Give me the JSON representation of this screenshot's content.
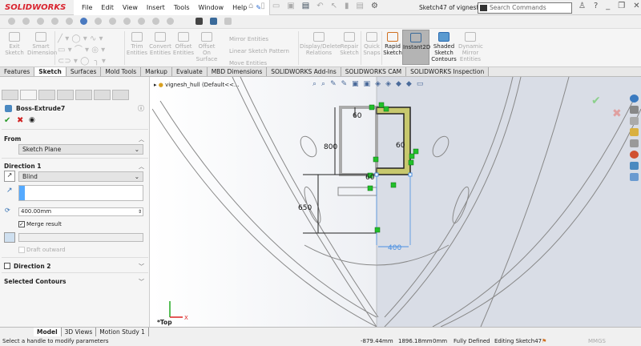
{
  "app": {
    "logo": "SOLIDWORKS",
    "document_title": "Sketch47 of vignesh_...",
    "search_placeholder": "Search Commands"
  },
  "menu": [
    "File",
    "Edit",
    "View",
    "Insert",
    "Tools",
    "Window",
    "Help"
  ],
  "ribbon": {
    "exit_sketch": "Exit Sketch",
    "smart_dimension": "Smart Dimension",
    "trim": "Trim Entities",
    "convert": "Convert Entities",
    "offset": "Offset Entities",
    "offset_surface": "Offset On Surface",
    "mirror": "Mirror Entities",
    "linear_pattern": "Linear Sketch Pattern",
    "move": "Move Entities",
    "display_delete": "Display/Delete Relations",
    "repair": "Repair Sketch",
    "quick_snaps": "Quick Snaps",
    "rapid_sketch": "Rapid Sketch",
    "instant2d": "Instant2D",
    "shaded_contours": "Shaded Sketch Contours",
    "dynamic_mirror": "Dynamic Mirror Entities"
  },
  "tabs": [
    "Features",
    "Sketch",
    "Surfaces",
    "Mold Tools",
    "Markup",
    "Evaluate",
    "MBD Dimensions",
    "SOLIDWORKS Add-Ins",
    "SOLIDWORKS CAM",
    "SOLIDWORKS Inspection"
  ],
  "active_tab": "Sketch",
  "feature": {
    "name": "Boss-Extrude7",
    "from": {
      "label": "From",
      "value": "Sketch Plane"
    },
    "direction1": {
      "label": "Direction 1",
      "end_condition": "Blind",
      "depth": "400.00mm",
      "merge_result": "Merge result",
      "merge_checked": true,
      "draft_outward": "Draft outward"
    },
    "direction2": "Direction 2",
    "selected_contours": "Selected Contours"
  },
  "tree": {
    "root": "vignesh_hull (Default<<..."
  },
  "dimensions": {
    "top": "60",
    "right": "60",
    "bottom": "60",
    "height": "800",
    "offset": "650",
    "width": "400"
  },
  "view_label": "*Top",
  "bottom_tabs": [
    "Model",
    "3D Views",
    "Motion Study 1"
  ],
  "status": {
    "message": "Select a handle to modify parameters",
    "x": "-879.44mm",
    "y": "1896.18mm",
    "z": "0mm",
    "state": "Fully Defined",
    "editing": "Editing Sketch47",
    "units": "MMGS"
  },
  "colors": {
    "brand": "#d9232e",
    "sketch_fill": "#c8c86e",
    "relation": "#22c02a",
    "dim_blue": "#4a90e2",
    "accent_blue": "#55aaff"
  }
}
